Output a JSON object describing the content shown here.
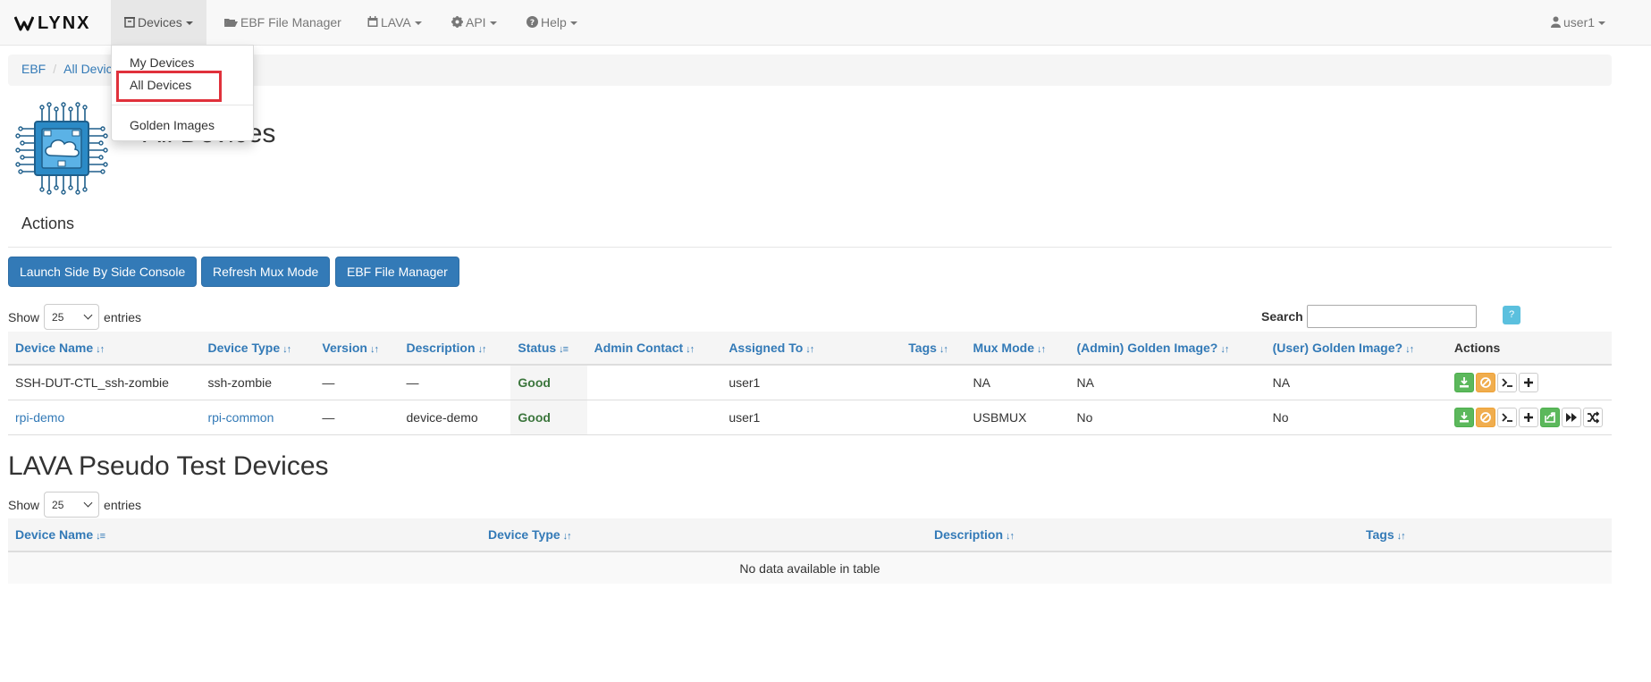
{
  "nav": {
    "brand": "LYNX",
    "items": [
      {
        "label": "Devices"
      },
      {
        "label": "EBF File Manager"
      },
      {
        "label": "LAVA"
      },
      {
        "label": "API"
      },
      {
        "label": "Help"
      }
    ],
    "user": "user1"
  },
  "dropdown": {
    "items": [
      "My Devices",
      "All Devices",
      "Golden Images"
    ]
  },
  "breadcrumb": [
    "EBF",
    "All Devic"
  ],
  "page_title": "All Devices",
  "actions": {
    "heading": "Actions",
    "buttons": [
      "Launch Side By Side Console",
      "Refresh Mux Mode",
      "EBF File Manager"
    ]
  },
  "devices_table": {
    "show_label": "Show",
    "entries_value": "25",
    "entries_label": "entries",
    "search_label": "Search",
    "help_label": "?",
    "headers": [
      "Device Name",
      "Device Type",
      "Version",
      "Description",
      "Status",
      "Admin Contact",
      "Assigned To",
      "Tags",
      "Mux Mode",
      "(Admin) Golden Image?",
      "(User) Golden Image?",
      "Actions"
    ],
    "rows": [
      {
        "name": "SSH-DUT-CTL_ssh-zombie",
        "type": "ssh-zombie",
        "version": "—",
        "description": "—",
        "status": "Good",
        "admin": "",
        "assigned": "user1",
        "tags": "",
        "mux": "NA",
        "admin_golden": "NA",
        "user_golden": "NA"
      },
      {
        "name": "rpi-demo",
        "type": "rpi-common",
        "version": "—",
        "description": "device-demo",
        "status": "Good",
        "admin": "",
        "assigned": "user1",
        "tags": "",
        "mux": "USBMUX",
        "admin_golden": "No",
        "user_golden": "No"
      }
    ]
  },
  "lava": {
    "title": "LAVA Pseudo Test Devices",
    "show_label": "Show",
    "entries_value": "25",
    "entries_label": "entries",
    "headers": [
      "Device Name",
      "Device Type",
      "Description",
      "Tags"
    ],
    "empty_text": "No data available in table"
  }
}
